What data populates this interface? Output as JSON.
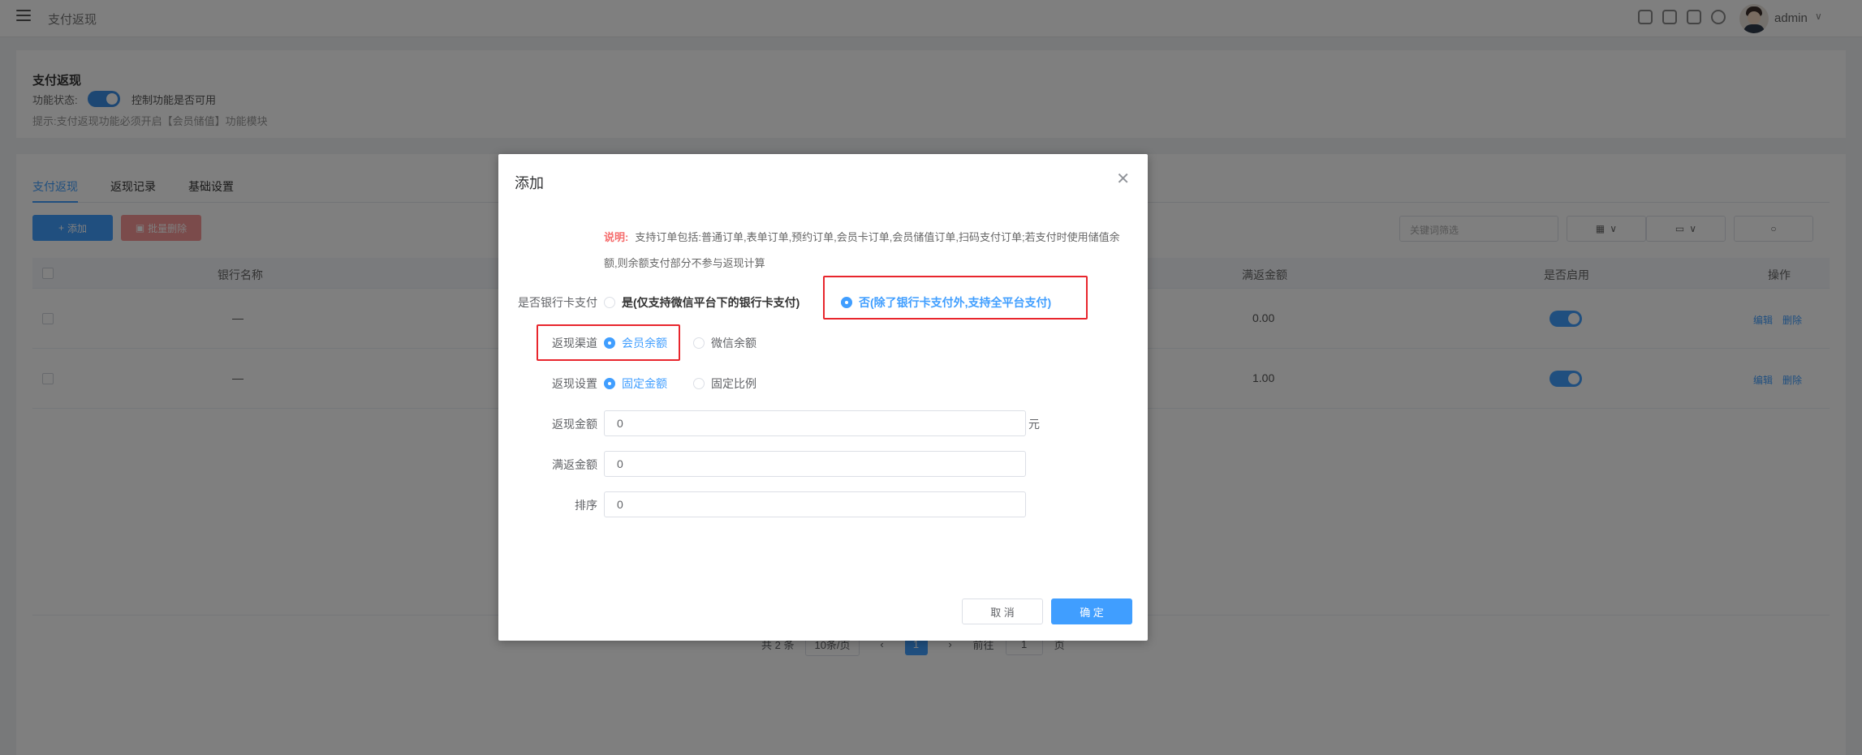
{
  "topbar": {
    "title": "支付返现",
    "user_name": "admin",
    "icons": [
      "printer-icon",
      "shirt-icon",
      "fullscreen-icon",
      "refresh-icon"
    ]
  },
  "info": {
    "title": "支付返现",
    "status_label": "功能状态:",
    "switch_text": "控制功能是否可用",
    "tip": "提示:支付返现功能必须开启【会员储值】功能模块"
  },
  "tabs": [
    "支付返现",
    "返现记录",
    "基础设置"
  ],
  "toolbar": {
    "add_label": "添加",
    "batch_delete_label": "批量删除",
    "search_placeholder": "关键词筛选"
  },
  "table": {
    "headers": [
      "银行名称",
      "满返金额",
      "是否启用",
      "操作"
    ],
    "rows": [
      {
        "bank": "—",
        "amount": "0.00",
        "edit": "编辑",
        "delete": "删除"
      },
      {
        "bank": "—",
        "amount": "1.00",
        "edit": "编辑",
        "delete": "删除"
      }
    ]
  },
  "pager": {
    "total": "共 2 条",
    "page_size": "10条/页",
    "current": "1",
    "goto_label": "前往",
    "goto_value": "1",
    "page_suffix": "页"
  },
  "dialog": {
    "title": "添加",
    "note_label": "说明:",
    "note_text": "支持订单包括:普通订单,表单订单,预约订单,会员卡订单,会员储值订单,扫码支付订单;若支付时使用储值余额,则余额支付部分不参与返现计算",
    "bank_pay": {
      "label": "是否银行卡支付",
      "option_yes": "是(仅支持微信平台下的银行卡支付)",
      "option_no": "否(除了银行卡支付外,支持全平台支付)"
    },
    "channel": {
      "label": "返现渠道",
      "option_member": "会员余额",
      "option_wechat": "微信余额"
    },
    "setting": {
      "label": "返现设置",
      "option_fixed": "固定金额",
      "option_ratio": "固定比例"
    },
    "cash_amount": {
      "label": "返现金额",
      "value": "0",
      "unit": "元"
    },
    "threshold": {
      "label": "满返金额",
      "value": "0"
    },
    "sort": {
      "label": "排序",
      "value": "0"
    },
    "cancel_label": "取 消",
    "confirm_label": "确 定"
  }
}
